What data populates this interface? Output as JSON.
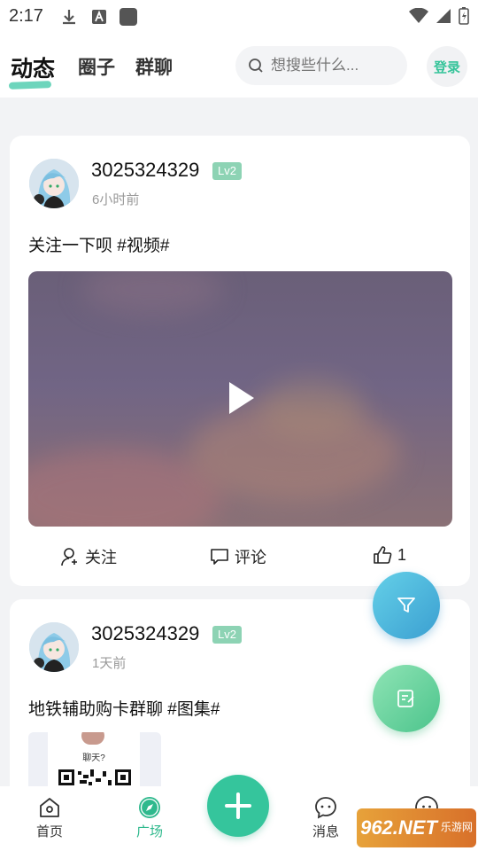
{
  "status_bar": {
    "time": "2:17"
  },
  "header": {
    "tabs": [
      {
        "label": "动态",
        "active": true
      },
      {
        "label": "圈子",
        "active": false
      },
      {
        "label": "群聊",
        "active": false
      }
    ],
    "search_placeholder": "想搜些什么...",
    "login_label": "登录"
  },
  "posts": [
    {
      "username": "3025324329",
      "level": "Lv2",
      "time": "6小时前",
      "text": "关注一下呗 #视频#",
      "media": "video",
      "actions": {
        "follow": "关注",
        "comment": "评论",
        "like_count": "1"
      }
    },
    {
      "username": "3025324329",
      "level": "Lv2",
      "time": "1天前",
      "text": "地铁辅助购卡群聊 #图集#",
      "media": "image",
      "thumb_text": "聊天?"
    }
  ],
  "bottom_nav": [
    {
      "label": "首页",
      "icon": "home-icon",
      "active": false
    },
    {
      "label": "广场",
      "icon": "compass-icon",
      "active": true
    },
    {
      "label": "消息",
      "icon": "message-icon",
      "active": false
    }
  ],
  "watermark": {
    "main": "962.NET",
    "sub": "乐游网"
  },
  "colors": {
    "accent": "#35c59c",
    "level_badge": "#8dd3b4",
    "filter_fab": "#4fb8de",
    "edit_fab": "#6cd49f"
  }
}
